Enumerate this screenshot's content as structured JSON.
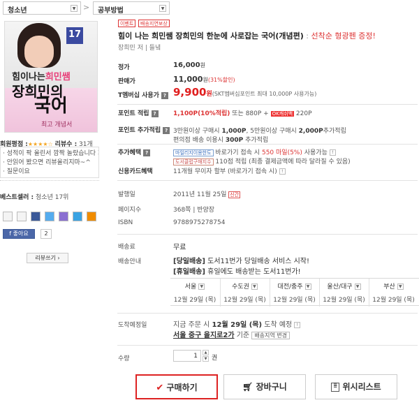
{
  "breadcrumb": {
    "category": "청소년",
    "subcategory": "공부방법",
    "sep": ">"
  },
  "badges": {
    "event": "이벤트",
    "delivery": "배송지연보상"
  },
  "title": {
    "main": "힘이 나는 희민쌤 장희민의 한눈에 사로잡는 국어(개념편)",
    "promo": "선착순 형광펜 증정!"
  },
  "author": "장희민 저 | 들녘",
  "cover": {
    "volume": "17",
    "line1a": "힘이나는",
    "line1b": "희민쌤",
    "line2": "장희민의",
    "line3": "국어",
    "line4": "최고 개념서"
  },
  "price": {
    "list_label": "정가",
    "list_value": "16,000",
    "won": "원",
    "sale_label": "판매가",
    "sale_value": "11,000",
    "sale_discount": "(31%할인)",
    "tmem_label": "T멤버십 사용가",
    "tmem_value": "9,900",
    "tmem_note": "(SKT멤버십포인트 최대 10,000P 사용가능)"
  },
  "points": {
    "label": "포인트 적립",
    "main": "1,100P(10%적립)",
    "or": "또는 880P +",
    "ok_badge": "OK캐쉬백",
    "ok_val": "220P",
    "extra_label": "포인트 추가적립",
    "extra1_a": "3만원이상 구매시",
    "extra1_b": "1,000P",
    "extra1_c": ", 5만원이상 구매시",
    "extra1_d": "2,000P",
    "extra1_e": "추가적립",
    "extra2_a": "편의점 배송 이용시",
    "extra2_b": "300P",
    "extra2_c": "추가적립"
  },
  "benefits": {
    "label": "추가혜택",
    "mileage_badge": "마일리지이용한도",
    "mileage_text": "바로가기 접속 시",
    "mileage_amt": "550 마일(5%)",
    "mileage_use": "사용가능",
    "culture_badge": "도서클럽구매지수",
    "culture_text": "110점 적립 (최종 결제금액에 따라 달라질 수 있음)",
    "card_label": "신용카드혜택",
    "card_text": "11개월 무이자 할부 (바로가기 접속 시)"
  },
  "info": {
    "pub_label": "발행일",
    "pub_value": "2011년 11월 25일",
    "pub_badge": "신간",
    "pages_label": "페이지수",
    "pages_value": "368쪽 | 반양장",
    "isbn_label": "ISBN",
    "isbn_value": "9788975278754"
  },
  "shipping": {
    "fee_label": "배송료",
    "fee_value": "무료",
    "guide_label": "배송안내",
    "guide1_tag": "[당일배송]",
    "guide1_text": "도서11번가 당일배송 서비스 시작!",
    "guide2_tag": "[휴일배송]",
    "guide2_text": "휴일에도 배송받는 도서11번가!",
    "cities": [
      {
        "name": "서울",
        "date": "12월 29일 (목)"
      },
      {
        "name": "수도권",
        "date": "12월 29일 (목)"
      },
      {
        "name": "대전/충주",
        "date": "12월 29일 (목)"
      },
      {
        "name": "울산/대구",
        "date": "12월 29일 (목)"
      },
      {
        "name": "부산",
        "date": "12월 29일 (목)"
      }
    ]
  },
  "arrival": {
    "label": "도착예정일",
    "line1_a": "지금 주문 시",
    "line1_date": "12월 29일 (목)",
    "line1_b": "도착 예정",
    "addr": "서울 중구 을지로2가",
    "addr_b": "기준",
    "change": "배송지역 변경"
  },
  "qty": {
    "label": "수량",
    "value": "1",
    "unit": "권"
  },
  "actions": {
    "buy": "구매하기",
    "cart": "장바구니",
    "wish": "위시리스트"
  },
  "sidebar": {
    "rating_label": "회원평점 :",
    "review_label": "리뷰수 :",
    "review_count": "31개",
    "reviews": [
      "· 성적이 팍 올린서 깜짝 놀랐습니다 희",
      "· 안읽어 봤으면 리뷰올리지마~^",
      "· 질문이요"
    ],
    "best_label": "베스트셀러 :",
    "best_value": "청소년 17위",
    "like": "좋아요",
    "like_count": "2",
    "write": "리뷰쓰기"
  }
}
